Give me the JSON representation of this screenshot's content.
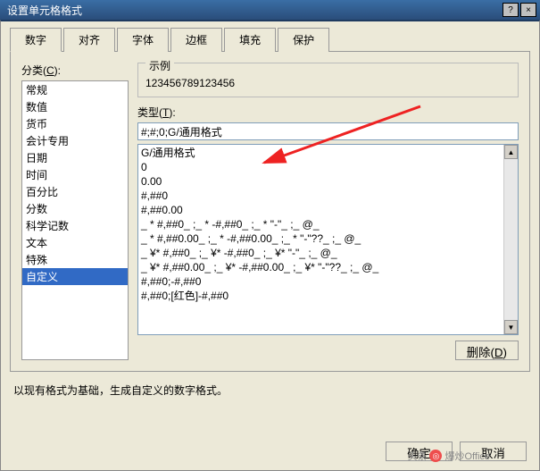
{
  "title": "设置单元格格式",
  "winbuttons": {
    "help": "?",
    "close": "×"
  },
  "tabs": [
    "数字",
    "对齐",
    "字体",
    "边框",
    "填充",
    "保护"
  ],
  "active_tab": 0,
  "left_label_prefix": "分类(",
  "left_label_hotkey": "C",
  "left_label_suffix": "):",
  "categories": [
    "常规",
    "数值",
    "货币",
    "会计专用",
    "日期",
    "时间",
    "百分比",
    "分数",
    "科学记数",
    "文本",
    "特殊",
    "自定义"
  ],
  "selected_category_index": 11,
  "sample_label": "示例",
  "sample_value": "123456789123456",
  "type_label_prefix": "类型(",
  "type_label_hotkey": "T",
  "type_label_suffix": "):",
  "type_value": "#;#;0;G/通用格式",
  "formats": [
    "G/通用格式",
    "0",
    "0.00",
    "#,##0",
    "#,##0.00",
    "_ * #,##0_ ;_ * -#,##0_ ;_ * \"-\"_ ;_ @_ ",
    "_ * #,##0.00_ ;_ * -#,##0.00_ ;_ * \"-\"??_ ;_ @_ ",
    "_ ¥* #,##0_ ;_ ¥* -#,##0_ ;_ ¥* \"-\"_ ;_ @_ ",
    "_ ¥* #,##0.00_ ;_ ¥* -#,##0.00_ ;_ ¥* \"-\"??_ ;_ @_ ",
    "#,##0;-#,##0",
    "#,##0;[红色]-#,##0"
  ],
  "delete_btn_prefix": "删除(",
  "delete_btn_hotkey": "D",
  "delete_btn_suffix": ")",
  "hint": "以现有格式为基础，生成自定义的数字格式。",
  "ok_btn": "确定",
  "cancel_btn": "取消",
  "watermark_prefix": "头条",
  "watermark_icon": "◎",
  "watermark_text": "爆炒Office"
}
